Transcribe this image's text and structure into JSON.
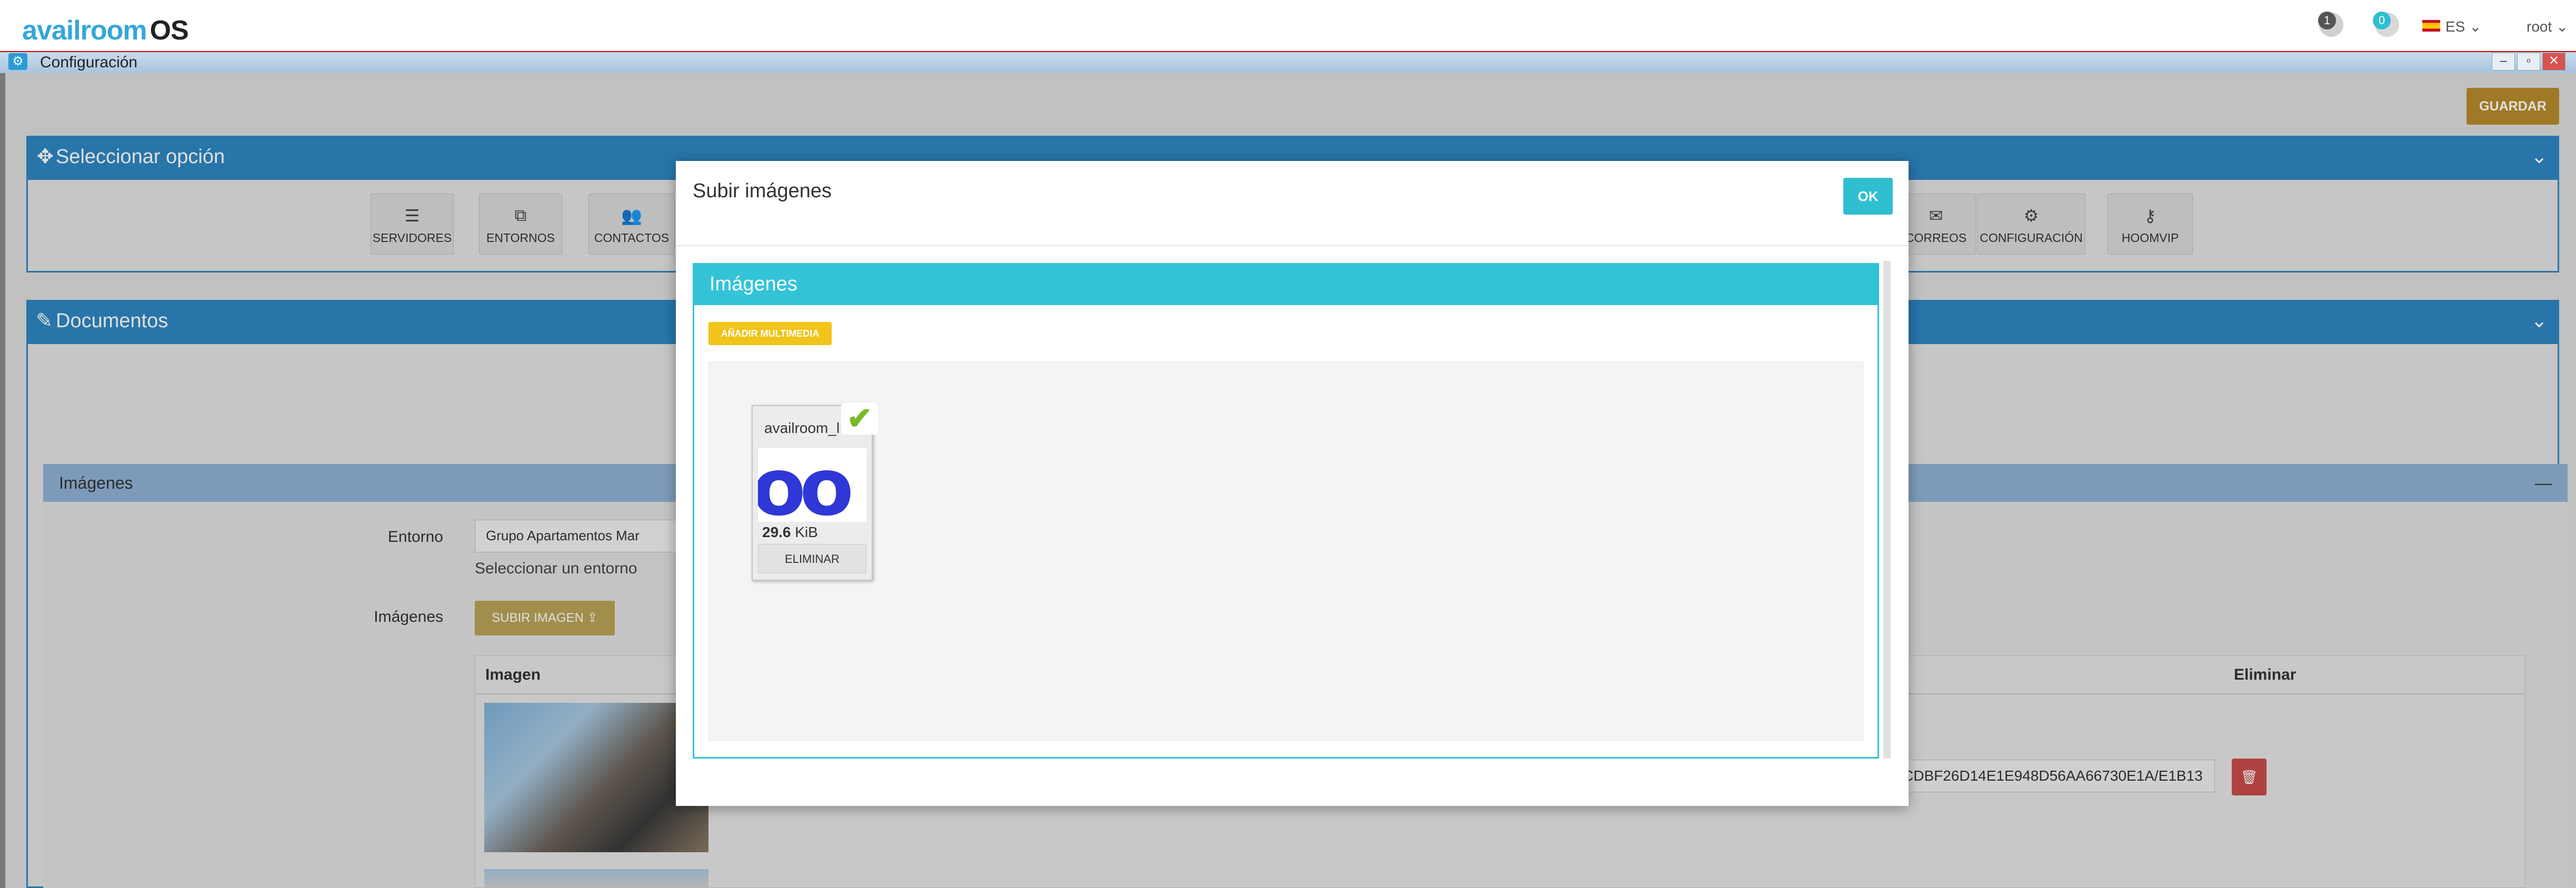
{
  "app": {
    "logo_main": "availroom",
    "logo_suffix": "OS",
    "notifications_count": "1",
    "alerts_count": "0",
    "language": "ES",
    "user": "root"
  },
  "window": {
    "title": "Configuración"
  },
  "toolbar": {
    "save_label": "GUARDAR"
  },
  "select_panel": {
    "title": "Seleccionar opción",
    "options": [
      {
        "label": "SERVIDORES",
        "icon": "server-icon"
      },
      {
        "label": "ENTORNOS",
        "icon": "sitemap-icon"
      },
      {
        "label": "CONTACTOS",
        "icon": "users-icon"
      },
      {
        "label": "CORREOS",
        "icon": "envelope-icon"
      },
      {
        "label": "CONFIGURACIÓN",
        "icon": "cogs-icon"
      },
      {
        "label": "HOOMVIP",
        "icon": "key-icon"
      }
    ]
  },
  "documents_panel": {
    "title": "Documentos",
    "images_section": {
      "title": "Imágenes",
      "entorno_label": "Entorno",
      "entorno_value": "Grupo Apartamentos Mar",
      "entorno_help": "Seleccionar un entorno",
      "imagenes_label": "Imágenes",
      "upload_button": "SUBIR IMAGEN",
      "table": {
        "headers": [
          "Imagen",
          "Eliminar"
        ],
        "row1_hash": "CDBF26D14E1E948D56AA66730E1A/E1B13"
      }
    }
  },
  "modal": {
    "title": "Subir imágenes",
    "ok_label": "OK",
    "panel_title": "Imágenes",
    "add_media_label": "AÑADIR MULTIMEDIA",
    "file": {
      "name": "availroom_l",
      "preview_text": "oo",
      "size_value": "29.6",
      "size_unit": "KiB",
      "delete_label": "ELIMINAR"
    }
  },
  "colors": {
    "header_blue": "#2e86c1",
    "modal_cyan": "#33c3d6",
    "save_gold": "#b58a2b",
    "add_media_yellow": "#f0c419",
    "delete_red": "#c94a4a"
  }
}
